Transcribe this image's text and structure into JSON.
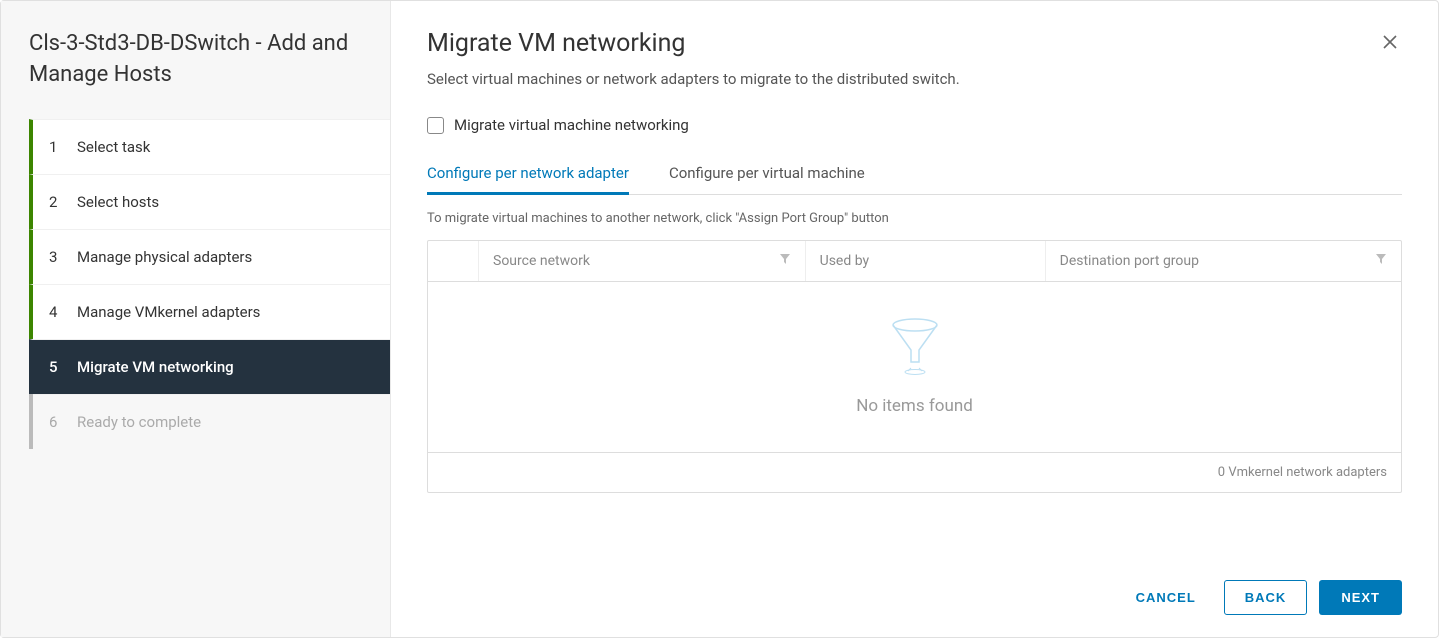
{
  "sidebar": {
    "title": "Cls-3-Std3-DB-DSwitch - Add and Manage Hosts",
    "steps": [
      {
        "num": "1",
        "label": "Select task"
      },
      {
        "num": "2",
        "label": "Select hosts"
      },
      {
        "num": "3",
        "label": "Manage physical adapters"
      },
      {
        "num": "4",
        "label": "Manage VMkernel adapters"
      },
      {
        "num": "5",
        "label": "Migrate VM networking"
      },
      {
        "num": "6",
        "label": "Ready to complete"
      }
    ]
  },
  "main": {
    "title": "Migrate VM networking",
    "subtitle": "Select virtual machines or network adapters to migrate to the distributed switch.",
    "checkbox_label": "Migrate virtual machine networking",
    "tabs": {
      "adapter": "Configure per network adapter",
      "vm": "Configure per virtual machine"
    },
    "hint": "To migrate virtual machines to another network, click \"Assign Port Group\" button",
    "columns": {
      "source": "Source network",
      "used_by": "Used by",
      "dest": "Destination port group"
    },
    "empty_text": "No items found",
    "footer": "0 Vmkernel network adapters"
  },
  "buttons": {
    "cancel": "CANCEL",
    "back": "BACK",
    "next": "NEXT"
  }
}
